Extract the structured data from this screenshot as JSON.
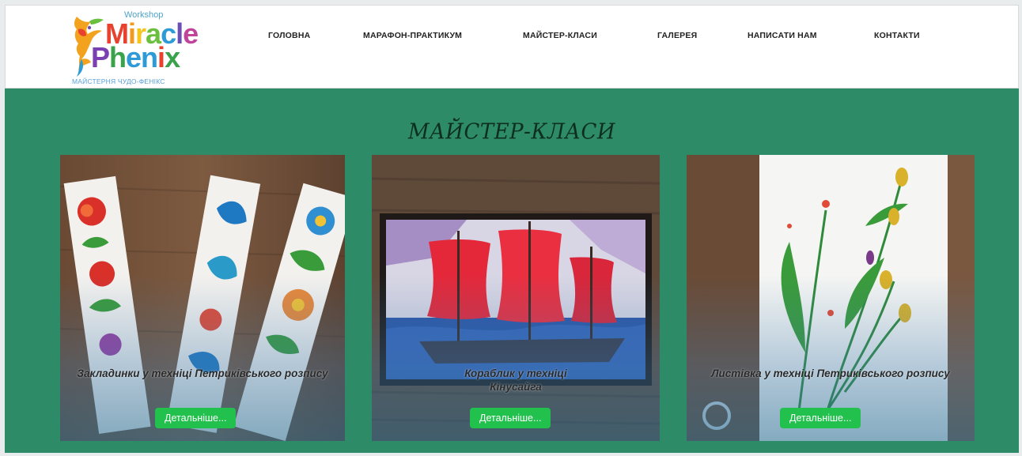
{
  "logo": {
    "workshop": "Workshop",
    "line1_letters": [
      "M",
      "i",
      "r",
      "a",
      "c",
      "l",
      "e"
    ],
    "line2_letters": [
      "P",
      "h",
      "e",
      "n",
      "i",
      "x"
    ],
    "subtitle": "МАЙСТЕРНЯ ЧУДО-ФЕНІКС",
    "colors": [
      "#e8412e",
      "#f29a1d",
      "#f2c51f",
      "#6bbf3f",
      "#2e9bd6",
      "#6d4fb3",
      "#c0459a"
    ]
  },
  "nav": {
    "items": [
      {
        "label": "ГОЛОВНА"
      },
      {
        "label": "МАРАФОН-ПРАКТИКУМ"
      },
      {
        "label": "МАЙСТЕР-КЛАСИ"
      },
      {
        "label": "ГАЛЕРЕЯ"
      },
      {
        "label": "НАПИСАТИ НАМ"
      },
      {
        "label": "КОНТАКТИ"
      }
    ]
  },
  "main": {
    "title": "МАЙСТЕР-КЛАСИ",
    "background": "#2e8b67",
    "cards": [
      {
        "title": "Закладинки у техніці Петриківського розпису",
        "button": "Детальніше..."
      },
      {
        "title": "Кораблик у техніці Кінусайга",
        "button": "Детальніше..."
      },
      {
        "title": "Листівка у техніці Петриківського розпису",
        "button": "Детальніше..."
      }
    ]
  },
  "colors": {
    "button": "#22c04d",
    "nav_text": "#222222"
  }
}
